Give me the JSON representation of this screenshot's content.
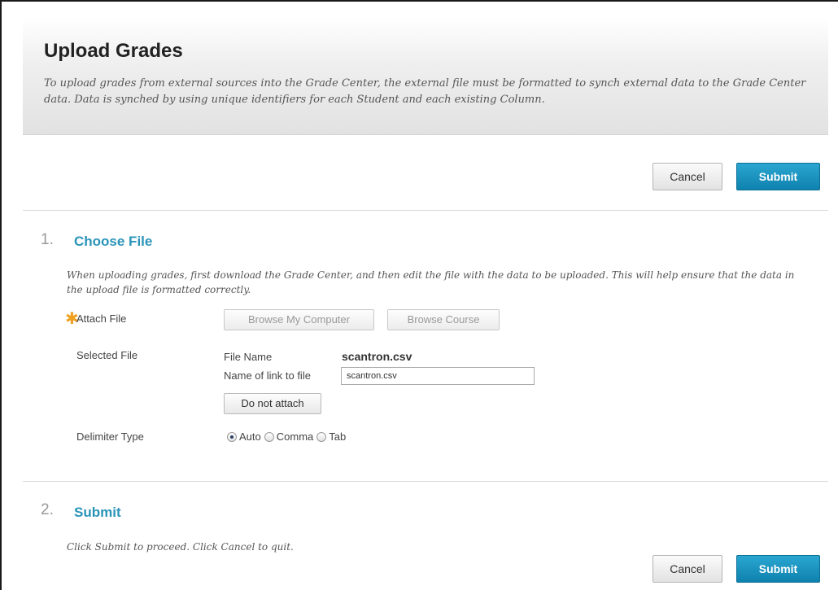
{
  "header": {
    "title": "Upload Grades",
    "description": "To upload grades from external sources into the Grade Center, the external file must be formatted to synch external data to the Grade Center data. Data is synched by using unique identifiers for each Student and each existing Column."
  },
  "top_actions": {
    "cancel_label": "Cancel",
    "submit_label": "Submit"
  },
  "step1": {
    "number": "1.",
    "title": "Choose File",
    "instructions": "When uploading grades, first download the Grade Center, and then edit the file with the data to be uploaded. This will help ensure that the data in the upload file is formatted correctly.",
    "attach_label": "Attach File",
    "required_icon": "asterisk-icon",
    "browse_computer_label": "Browse My Computer",
    "browse_course_label": "Browse Course",
    "selected_file_label": "Selected File",
    "file_name_label": "File Name",
    "file_name_value": "scantron.csv",
    "link_name_label": "Name of link to file",
    "link_name_value": "scantron.csv",
    "do_not_attach_label": "Do not attach",
    "delimiter_label": "Delimiter Type",
    "delimiter_options": [
      "Auto",
      "Comma",
      "Tab"
    ],
    "delimiter_selected": "Auto"
  },
  "step2": {
    "number": "2.",
    "title": "Submit",
    "instructions": "Click Submit to proceed. Click Cancel to quit."
  },
  "bottom_actions": {
    "cancel_label": "Cancel",
    "submit_label": "Submit"
  },
  "colors": {
    "accent": "#2a94b8",
    "submit_button": "#1792bf",
    "required_star": "#f0a020"
  }
}
